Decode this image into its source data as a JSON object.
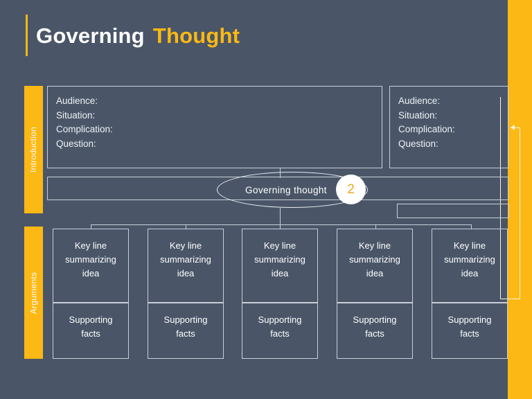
{
  "slide": {
    "background_color": "#4a5668",
    "accent_color": "#fcb814",
    "line_color": "#c9cfd8",
    "title_part_one": "Governing",
    "title_part_two": "Thought"
  },
  "sections": {
    "introduction_label": "Introduction",
    "arguments_label": "Arguments"
  },
  "introduction": {
    "left_box": {
      "field_audience": "Audience:",
      "field_situation": "Situation:",
      "field_complication": "Complication:",
      "field_question": "Question:"
    },
    "right_box": {
      "field_audience": "Audience:",
      "field_situation": "Situation:",
      "field_complication": "Complication:",
      "field_question": "Question:"
    }
  },
  "governing_thought": {
    "label": "Governing thought",
    "step_number": "2",
    "step_number_color": "#f0a81c"
  },
  "arguments": {
    "columns": [
      {
        "key_line": "Key line\nsummarizing\nidea",
        "supporting": "Supporting\nfacts"
      },
      {
        "key_line": "Key line\nsummarizing\nidea",
        "supporting": "Supporting\nfacts"
      },
      {
        "key_line": "Key line\nsummarizing\nidea",
        "supporting": "Supporting\nfacts"
      },
      {
        "key_line": "Key line\nsummarizing\nidea",
        "supporting": "Supporting\nfacts"
      },
      {
        "key_line": "Key line\nsummarizing\nidea",
        "supporting": "Supporting\nfacts"
      }
    ],
    "key_line_text_l1": "Key line",
    "key_line_text_l2": "summarizing",
    "key_line_text_l3": "idea",
    "supporting_text_l1": "Supporting",
    "supporting_text_l2": "facts"
  }
}
